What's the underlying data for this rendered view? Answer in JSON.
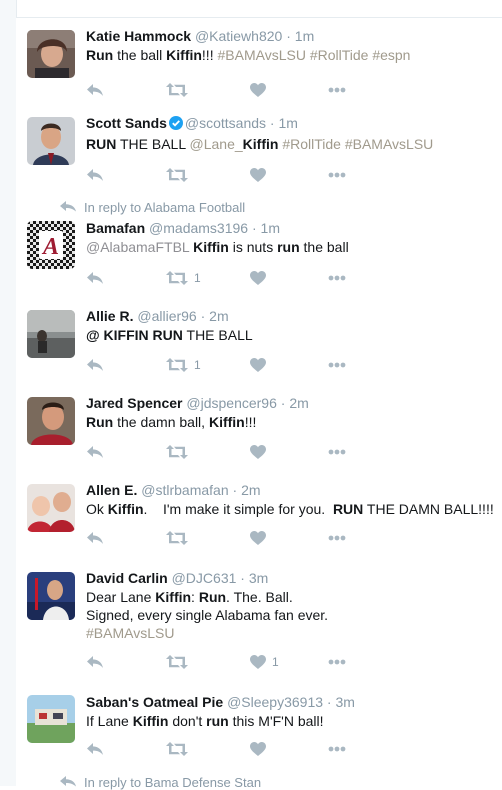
{
  "top_partial": {},
  "tweets": [
    {
      "name": "Katie Hammock",
      "handle": "@Katiewh820",
      "time": "1m",
      "segments": [
        {
          "t": "Run",
          "s": "b"
        },
        {
          "t": " the ball ",
          "s": ""
        },
        {
          "t": "Kiffin",
          "s": "b"
        },
        {
          "t": "!!! ",
          "s": ""
        },
        {
          "t": "#BAMAvsLSU #RollTide #espn",
          "s": "hash"
        }
      ],
      "retweet_count": "",
      "like_count": ""
    },
    {
      "name": "Scott Sands",
      "handle": "@scottsands",
      "time": "1m",
      "verified": true,
      "segments": [
        {
          "t": "RUN",
          "s": "b"
        },
        {
          "t": " THE BALL ",
          "s": ""
        },
        {
          "t": "@Lane_",
          "s": "hash"
        },
        {
          "t": "Kiffin",
          "s": "b"
        },
        {
          "t": " ",
          "s": ""
        },
        {
          "t": "#RollTide #BAMAvsLSU",
          "s": "hash"
        }
      ],
      "retweet_count": "",
      "like_count": ""
    },
    {
      "reply_context": "In reply to Alabama Football",
      "name": "Bamafan",
      "handle": "@madams3196",
      "time": "1m",
      "segments": [
        {
          "t": "@AlabamaFTBL",
          "s": "hl"
        },
        {
          "t": " ",
          "s": ""
        },
        {
          "t": "Kiffin",
          "s": "b"
        },
        {
          "t": " is nuts ",
          "s": ""
        },
        {
          "t": "run",
          "s": "b"
        },
        {
          "t": " the ball",
          "s": ""
        }
      ],
      "retweet_count": "1",
      "like_count": ""
    },
    {
      "name": "Allie R.",
      "handle": "@allier96",
      "time": "2m",
      "segments": [
        {
          "t": "@ ",
          "s": "b"
        },
        {
          "t": "KIFFIN RUN",
          "s": "b"
        },
        {
          "t": " THE BALL",
          "s": ""
        }
      ],
      "retweet_count": "1",
      "like_count": ""
    },
    {
      "name": "Jared Spencer",
      "handle": "@jdspencer96",
      "time": "2m",
      "segments": [
        {
          "t": "Run",
          "s": "b"
        },
        {
          "t": " the damn ball, ",
          "s": ""
        },
        {
          "t": "Kiffin",
          "s": "b"
        },
        {
          "t": "!!!",
          "s": ""
        }
      ],
      "retweet_count": "",
      "like_count": ""
    },
    {
      "name": "Allen E.",
      "handle": "@stlrbamafan",
      "time": "2m",
      "segments": [
        {
          "t": "Ok ",
          "s": ""
        },
        {
          "t": "Kiffin",
          "s": "b"
        },
        {
          "t": ".    I'm make it simple for you.  ",
          "s": ""
        },
        {
          "t": "RUN",
          "s": "b"
        },
        {
          "t": " THE DAMN BALL!!!!",
          "s": ""
        }
      ],
      "retweet_count": "",
      "like_count": ""
    },
    {
      "name": "David Carlin",
      "handle": "@DJC631",
      "time": "3m",
      "lines": [
        [
          {
            "t": "Dear Lane ",
            "s": ""
          },
          {
            "t": "Kiffin",
            "s": "b"
          },
          {
            "t": ": ",
            "s": ""
          },
          {
            "t": "Run",
            "s": "b"
          },
          {
            "t": ". The. Ball.",
            "s": ""
          }
        ],
        [
          {
            "t": "Signed, every single Alabama fan ever.",
            "s": ""
          }
        ],
        [
          {
            "t": "#BAMAvsLSU",
            "s": "hash"
          }
        ]
      ],
      "retweet_count": "",
      "like_count": "1"
    },
    {
      "name": "Saban's Oatmeal Pie",
      "handle": "@Sleepy36913",
      "time": "3m",
      "segments": [
        {
          "t": "If Lane ",
          "s": ""
        },
        {
          "t": "Kiffin",
          "s": "b"
        },
        {
          "t": " don't ",
          "s": ""
        },
        {
          "t": "run",
          "s": "b"
        },
        {
          "t": " this M'F'N ball!",
          "s": ""
        }
      ],
      "retweet_count": "",
      "like_count": ""
    }
  ],
  "bottom_partial": {
    "reply_context": "In reply to Bama Defense Stan"
  },
  "colors": {
    "icon": "#aab8c2",
    "secondary": "#8899a6",
    "verified": "#1da1f2"
  },
  "icons": [
    "reply-icon",
    "retweet-icon",
    "like-icon",
    "more-icon",
    "reply-context-icon",
    "verified-icon"
  ]
}
